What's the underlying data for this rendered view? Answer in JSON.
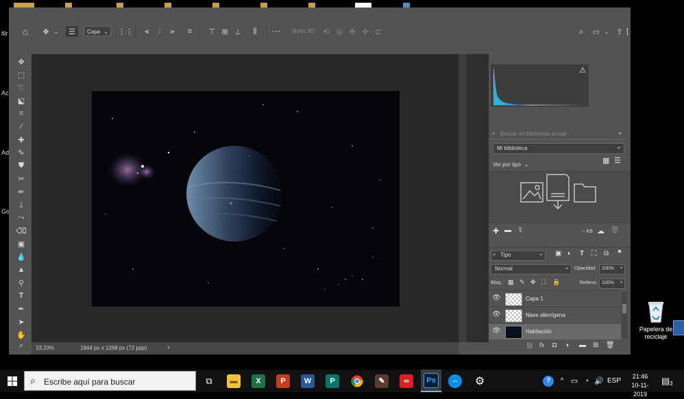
{
  "desktop": {
    "left_fragments": [
      "filr",
      "Ac",
      "Ad",
      "Go"
    ],
    "recycle_bin_label": "Papelera de reciclaje"
  },
  "options_bar": {
    "layer_select": "Capa",
    "mode_3d": "Modo 3D:"
  },
  "status_bar": {
    "zoom": "33,33%",
    "doc_info": "1844 px x 1268 px (72 ppp)",
    "arrow": "›"
  },
  "libraries": {
    "search_placeholder": "Buscar en biblioteca actual",
    "library_name": "Mi biblioteca",
    "view_by": "Ver por tipo",
    "size_label": "-- KB"
  },
  "layers_panel": {
    "filter_kind": "Tipo",
    "blend_mode": "Normal",
    "opacity_label": "Opacidad:",
    "opacity_value": "100%",
    "lock_label": "Bloq.:",
    "fill_label": "Relleno:",
    "fill_value": "100%",
    "layers": [
      {
        "name": "Capa 1"
      },
      {
        "name": "Nave alienígena"
      },
      {
        "name": "Habitación"
      }
    ]
  },
  "taskbar": {
    "search_placeholder": "Escribe aquí para buscar",
    "language": "ESP",
    "time": "21:46",
    "date": "10-11-2019",
    "notifications_count": "3"
  },
  "colors": {
    "ps_panel": "#535353",
    "canvas_bg": "#282828",
    "taskbar": "#111111",
    "accent_blue": "#1f6fd6"
  }
}
